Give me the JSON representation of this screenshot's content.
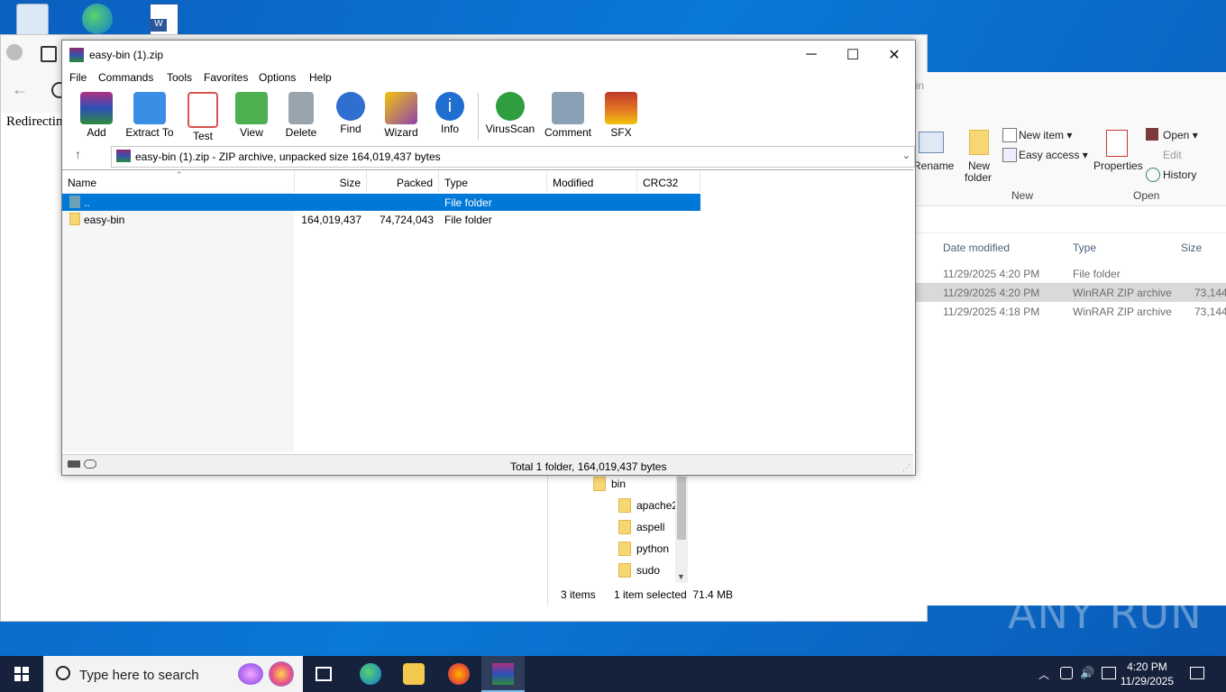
{
  "browser": {
    "page_text": "Redirectin"
  },
  "explorer": {
    "ribbon": {
      "rename": "Rename",
      "new_folder": "New\nfolder",
      "new_item": "New item",
      "easy_access": "Easy access",
      "properties": "Properties",
      "open": "Open",
      "edit": "Edit",
      "history": "History",
      "group_new": "New",
      "group_open": "Open",
      "path_fragment": "bin"
    },
    "columns": [
      "Date modified",
      "Type",
      "Size"
    ],
    "rows": [
      {
        "date": "11/29/2025 4:20 PM",
        "type": "File folder",
        "size": ""
      },
      {
        "date": "11/29/2025 4:20 PM",
        "type": "WinRAR ZIP archive",
        "size": "73,144"
      },
      {
        "date": "11/29/2025 4:18 PM",
        "type": "WinRAR ZIP archive",
        "size": "73,144"
      }
    ],
    "tree": [
      "bin",
      "apache2",
      "aspell",
      "python",
      "sudo"
    ],
    "status": {
      "items": "3 items",
      "selected": "1 item selected  71.4 MB"
    }
  },
  "winrar": {
    "title": "easy-bin (1).zip",
    "menu": [
      "File",
      "Commands",
      "Tools",
      "Favorites",
      "Options",
      "Help"
    ],
    "toolbar": [
      {
        "label": "Add",
        "icon": "add-archive-icon",
        "color": "#c0392b"
      },
      {
        "label": "Extract To",
        "icon": "extract-folder-icon",
        "color": "#3a8ee6"
      },
      {
        "label": "Test",
        "icon": "test-clipboard-icon",
        "color": "#d9534f"
      },
      {
        "label": "View",
        "icon": "view-book-icon",
        "color": "#4caf50"
      },
      {
        "label": "Delete",
        "icon": "trash-icon",
        "color": "#9aa4ad"
      },
      {
        "label": "Find",
        "icon": "magnifier-icon",
        "color": "#2f6fcf"
      },
      {
        "label": "Wizard",
        "icon": "wand-icon",
        "color": "#8e44ad"
      },
      {
        "label": "Info",
        "icon": "info-icon",
        "color": "#1e6fd0"
      },
      {
        "label": "VirusScan",
        "icon": "virus-scan-icon",
        "color": "#2e9e3e"
      },
      {
        "label": "Comment",
        "icon": "comment-icon",
        "color": "#8aa0b5"
      },
      {
        "label": "SFX",
        "icon": "sfx-box-icon",
        "color": "#e67e22"
      }
    ],
    "address": "easy-bin (1).zip - ZIP archive, unpacked size 164,019,437 bytes",
    "columns": [
      "Name",
      "Size",
      "Packed",
      "Type",
      "Modified",
      "CRC32"
    ],
    "rows": [
      {
        "name": "..",
        "size": "",
        "packed": "",
        "type": "File folder"
      },
      {
        "name": "easy-bin",
        "size": "164,019,437",
        "packed": "74,724,043",
        "type": "File folder"
      }
    ],
    "status": "Total 1 folder, 164,019,437 bytes"
  },
  "taskbar": {
    "search_placeholder": "Type here to search",
    "time": "4:20 PM",
    "date": "11/29/2025"
  },
  "watermark": "ANY RUN"
}
